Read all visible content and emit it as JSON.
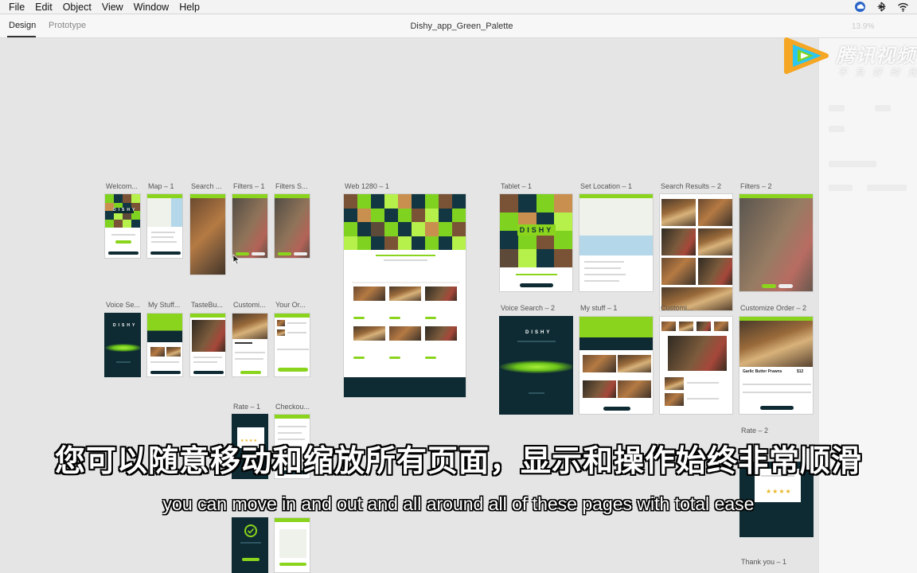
{
  "menubar": {
    "items": [
      "File",
      "Edit",
      "Object",
      "View",
      "Window",
      "Help"
    ],
    "tray_icons": [
      "creative-cloud-icon",
      "bluetooth-icon",
      "wifi-icon"
    ]
  },
  "toolbar": {
    "tabs": [
      {
        "label": "Design",
        "active": true
      },
      {
        "label": "Prototype",
        "active": false
      }
    ],
    "document_title": "Dishy_app_Green_Palette",
    "zoom": "13.9%"
  },
  "watermark": {
    "brand": "腾讯视频",
    "slogan": "不负好时光"
  },
  "artboards": {
    "welcome_1": "Welcom...",
    "map_1": "Map – 1",
    "search_1": "Search ...",
    "filters_1": "Filters – 1",
    "filters_s": "Filters S...",
    "web_1280_1": "Web 1280 – 1",
    "tablet_1": "Tablet – 1",
    "set_location_1": "Set Location – 1",
    "search_results_2": "Search Results – 2",
    "filters_2": "Filters – 2",
    "voice_search": "Voice Se...",
    "my_stuff": "My Stuff...",
    "tastebu": "TasteBu...",
    "customi": "Customi...",
    "your_or": "Your Or...",
    "voice_search_2": "Voice Search – 2",
    "my_stuff_1": "My stuff – 1",
    "customize_order_2": "Customize Order – 2",
    "rate_1": "Rate – 1",
    "checkout": "Checkou...",
    "rate_2": "Rate – 2",
    "thank_you_1": "Thank you – 1"
  },
  "mock": {
    "dishy": "DISHY",
    "garlic_butter_prawns": "Garlic Butter Prawns",
    "price": "$12",
    "stars": "★★★★"
  },
  "colors": {
    "accent_green": "#8bd41d",
    "dark_teal": "#0e2b33",
    "canvas": "#e5e5e5"
  },
  "subtitles": {
    "chinese": "您可以随意移动和缩放所有页面，显示和操作始终非常顺滑",
    "english": "you can move in and out and all around all of these pages with total ease"
  }
}
